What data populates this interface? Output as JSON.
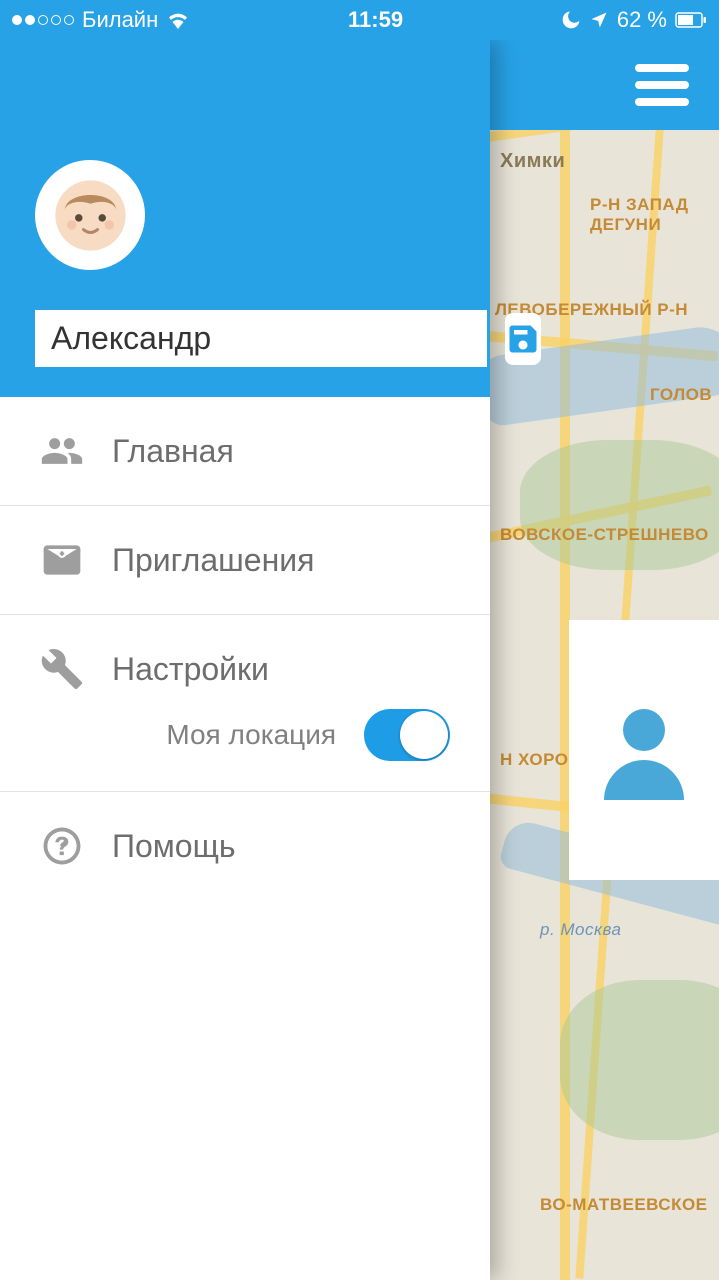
{
  "status_bar": {
    "carrier": "Билайн",
    "time": "11:59",
    "battery_text": "62 %"
  },
  "drawer": {
    "name_value": "Александр",
    "menu": {
      "home": "Главная",
      "invitations": "Приглашения",
      "settings": "Настройки",
      "location_toggle_label": "Моя локация",
      "help": "Помощь"
    }
  },
  "map": {
    "labels": {
      "khimki": "Химки",
      "west_degun": "Р-Н ЗАПАД\nДЕГУНИ",
      "levoberezh": "ЛЕВОБЕРЕЖНЫЙ Р-Н",
      "golov": "ГОЛОВ",
      "pokrov_stresh": "ВОВСКОЕ-СТРЕШНЕВО",
      "khorosh": "Н ХОРОШ",
      "moskva_river": "р. Москва",
      "matveevskoe": "ВО-МАТВЕЕВСКОЕ"
    }
  }
}
